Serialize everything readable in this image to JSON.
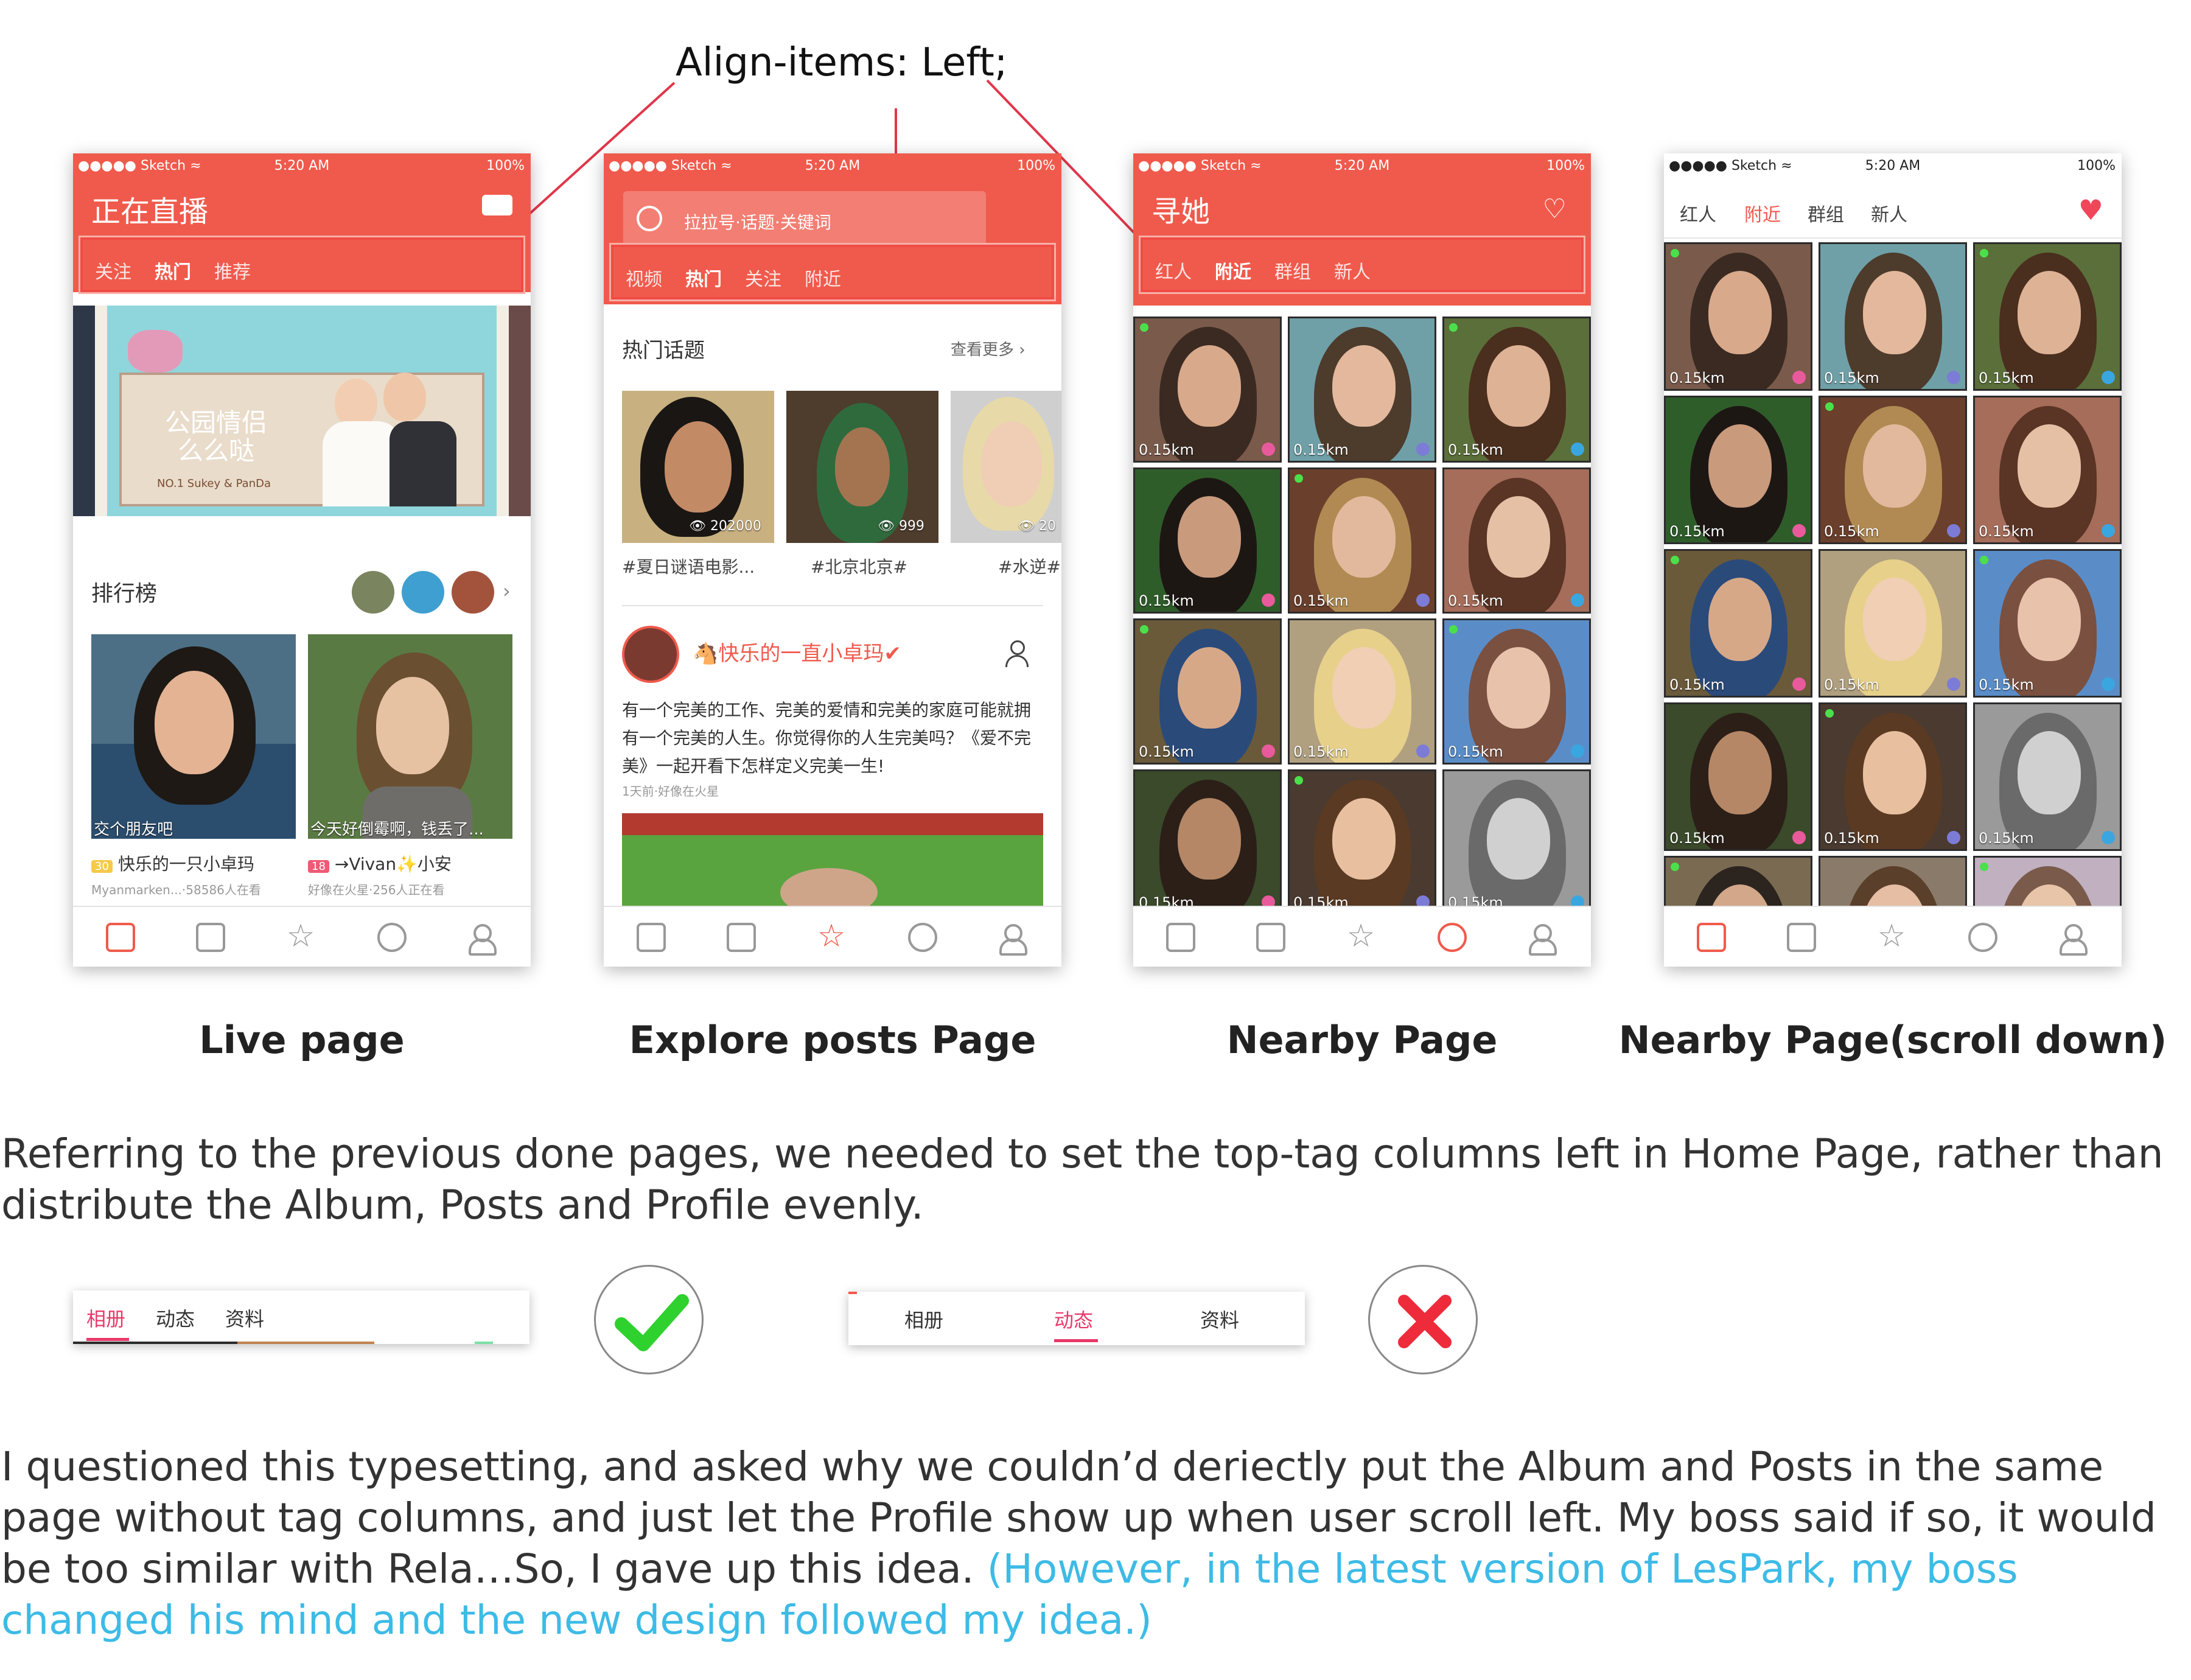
{
  "annotation": {
    "text": "Align-items: Left;"
  },
  "status": {
    "left": "●●●●● Sketch ≈",
    "time": "5:20 AM",
    "battery": "100%"
  },
  "phones": {
    "live": {
      "title": "正在直播",
      "tabs": [
        "关注",
        "热门",
        "推荐"
      ],
      "banner_text_1": "公园情侣",
      "banner_text_2": "么么哒",
      "banner_sub": "NO.1 Sukey & PanDa",
      "ranking_label": "排行榜",
      "card1_caption": "交个朋友吧",
      "card2_caption": "今天好倒霉啊，钱丢了...",
      "card1_level": "30",
      "card1_name": "快乐的一只小卓玛",
      "card2_level": "18",
      "card2_name": "→Vivan✨小安",
      "card1_meta": "Myanmarken...·58586人在看",
      "card2_meta": "好像在火星·256人正在看"
    },
    "explore": {
      "search_placeholder": "拉拉号·话题·关键词",
      "tabs": [
        "视频",
        "热门",
        "关注",
        "附近"
      ],
      "topics_label": "热门话题",
      "see_more": "查看更多",
      "topic1_views": "202000",
      "topic2_views": "999",
      "topic3_views": "20",
      "topic1_tag": "#夏日谜语电影...",
      "topic2_tag": "#北京北京#",
      "topic3_tag": "#水逆#",
      "post_user": "🐴快乐的一直小卓玛✔",
      "post_text": "有一个完美的工作、完美的爱情和完美的家庭可能就拥有一个完美的人生。你觉得你的人生完美吗？《爱不完美》一起开看下怎样定义完美一生!",
      "post_meta": "1天前·好像在火星"
    },
    "nearby": {
      "title": "寻她",
      "tabs": [
        "红人",
        "附近",
        "群组",
        "新人"
      ],
      "distance": "0.15km"
    },
    "nearby_scroll": {
      "tabs": [
        "红人",
        "附近",
        "群组",
        "新人"
      ],
      "distance": "0.15km"
    }
  },
  "captions": {
    "live": "Live page",
    "explore": "Explore posts Page",
    "nearby": "Nearby Page",
    "nearby_scroll": "Nearby Page(scroll down)"
  },
  "paragraph1": "Referring to the previous done pages, we needed to set the top-tag columns left in Home Page, rather than distribute the Album, Posts and Profile evenly.",
  "strip_left": {
    "tabs": [
      "相册",
      "动态",
      "资料"
    ]
  },
  "strip_right": {
    "tabs": [
      "相册",
      "动态",
      "资料"
    ]
  },
  "paragraph2": {
    "main": "I questioned this typesetting, and asked why we couldn’d deriectly put the Album and Posts in the same page without tag columns, and just let the Profile show up when user scroll left. My boss said if so, it would be too similar with Rela…So, I gave up this idea. ",
    "highlight": "(However, in the latest version of LesPark, my boss changed his mind and the new design followed my idea.)"
  },
  "colors": {
    "brand_red": "#f05a4c",
    "accent_pink": "#e8396a",
    "link_blue": "#3dbbe6",
    "check_green": "#2fd12f",
    "cross_red": "#ee2b3a"
  }
}
